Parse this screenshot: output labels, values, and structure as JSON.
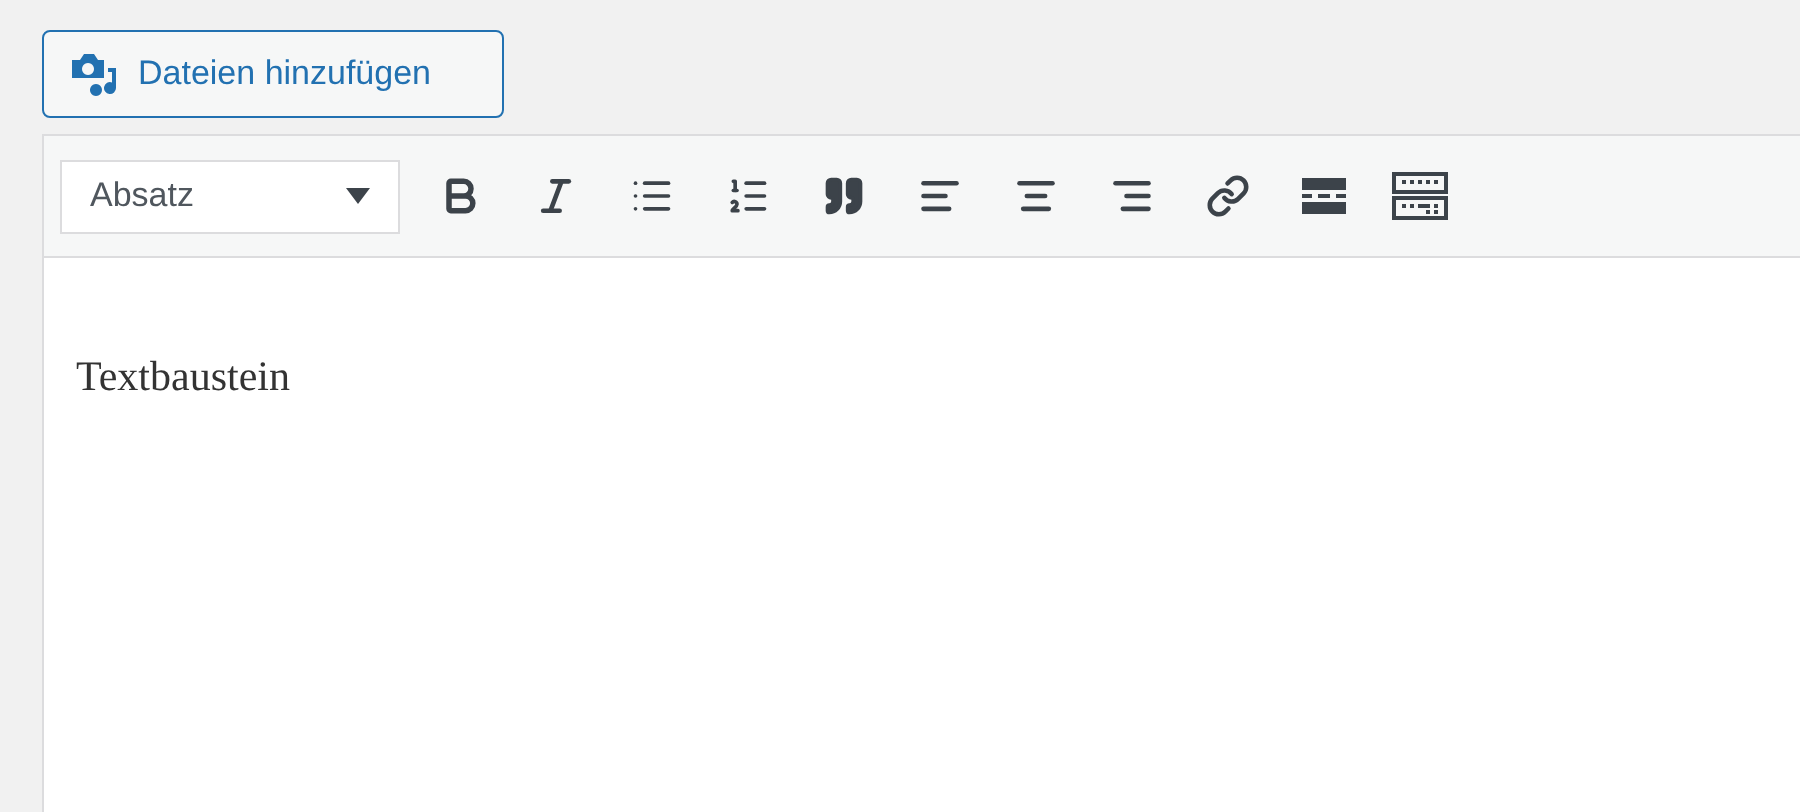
{
  "media_button": {
    "label": "Dateien hinzufügen"
  },
  "format_select": {
    "value": "Absatz"
  },
  "content": {
    "text": "Textbaustein"
  }
}
